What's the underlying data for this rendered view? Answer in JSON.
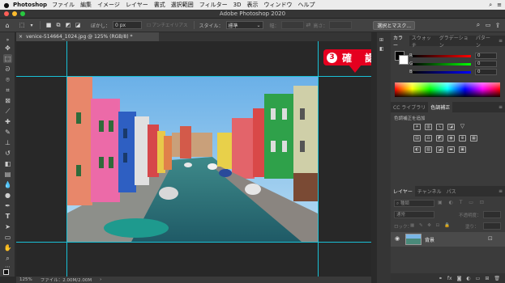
{
  "menubar": {
    "apple": "",
    "app": "Photoshop",
    "items": [
      "ファイル",
      "編集",
      "イメージ",
      "レイヤー",
      "書式",
      "選択範囲",
      "フィルター",
      "3D",
      "表示",
      "ウィンドウ",
      "ヘルプ"
    ],
    "right_icons": [
      "search-icon",
      "menu-icon"
    ]
  },
  "window": {
    "title": "Adobe Photoshop 2020"
  },
  "options": {
    "feather_label": "ぼかし：",
    "feather_value": "0 px",
    "antialias": "アンチエイリアス",
    "style_label": "スタイル：",
    "style_value": "標準",
    "width_label": "幅：",
    "height_label": "高さ：",
    "select_mask": "選択とマスク..."
  },
  "document": {
    "tab_title": "venice-514664_1024.jpg @ 125% (RGB/8) *",
    "close": "×"
  },
  "callout": {
    "number": "3",
    "text": "確 認",
    "color": "#e5001f"
  },
  "status": {
    "zoom": "125%",
    "file": "ファイル：2.00M/2.00M"
  },
  "panels": {
    "color": {
      "tabs": [
        "カラー",
        "スウォッチ",
        "グラデーション",
        "パターン"
      ],
      "r_label": "R",
      "g_label": "G",
      "b_label": "B",
      "r": "0",
      "g": "0",
      "b": "0"
    },
    "libs": {
      "tabs": [
        "CC ライブラリ",
        "色調補正"
      ],
      "add_label": "色調補正を追加"
    },
    "layers": {
      "tabs": [
        "レイヤー",
        "チャンネル",
        "パス"
      ],
      "kind_placeholder": "種類",
      "blend_mode": "通常",
      "opacity_label": "不透明度：",
      "lock_label": "ロック：",
      "fill_label": "塗り：",
      "layer_name": "背景"
    }
  },
  "colors": {
    "guide": "#19c0d6",
    "accent": "#e5001f"
  }
}
